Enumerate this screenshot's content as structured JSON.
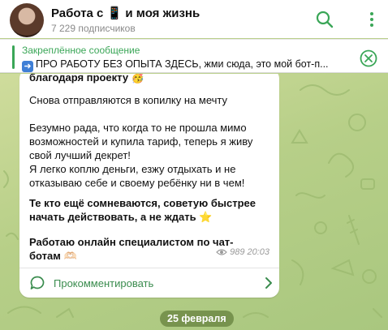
{
  "header": {
    "title": "Работа с 📱 и моя жизнь",
    "subscribers": "7 229 подписчиков"
  },
  "pinned": {
    "label": "Закреплённое сообщение",
    "text": "ПРО РАБОТУ БЕЗ ОПЫТА ЗДЕСЬ, жми сюда, это мой бот-п..."
  },
  "message": {
    "top_partial": "благодаря проекту 🥳",
    "p1": "Снова отправляются в копилку на мечту",
    "p2": "Безумно рада, что когда то не прошла мимо\nвозможностей и купила тариф, теперь я живу\nсвой лучший декрет!\nЯ легко коплю деньги, езжу отдыхать и не\nотказываю себе и своему ребёнку ни в чем!",
    "p3": "Те кто ещё сомневаются, советую быстрее\nначать действовать, а не ждать ⭐",
    "p4": "Работаю онлайн специалистом по чат-\nботам 🫶🏻",
    "views": "989",
    "time": "20:03",
    "comment_label": "Прокомментировать"
  },
  "date_separator": "25 февраля",
  "icons": {
    "search": "search-icon",
    "more": "more-vertical-icon",
    "close": "close-circle-icon",
    "eye": "eye-icon",
    "comment": "comment-bubble-icon",
    "chevron": "chevron-right-icon"
  },
  "colors": {
    "accent": "#3aa657",
    "chat_bg": "#b9cf8a",
    "date_pill": "#627e3a"
  }
}
